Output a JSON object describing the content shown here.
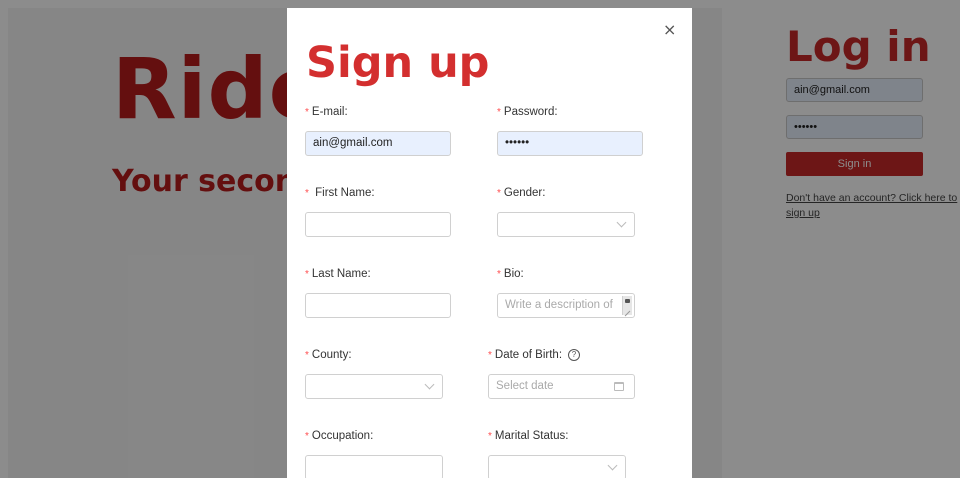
{
  "background": {
    "brand": "Ride",
    "tagline": "Your second",
    "login": {
      "title": "Log in",
      "email_value": "ain@gmail.com",
      "password_value": "••••••",
      "submit_label": "Sign in",
      "signup_link": "Don't have an account? Click here to sign up"
    }
  },
  "modal": {
    "title": "Sign up",
    "close_glyph": "×",
    "fields": {
      "email": {
        "label": "E-mail",
        "value": "ain@gmail.com"
      },
      "password": {
        "label": "Password",
        "value": "••••••"
      },
      "first_name": {
        "label": "First Name",
        "value": ""
      },
      "gender": {
        "label": "Gender",
        "value": ""
      },
      "last_name": {
        "label": "Last Name",
        "value": ""
      },
      "bio": {
        "label": "Bio",
        "placeholder": "Write a description of"
      },
      "county": {
        "label": "County",
        "value": ""
      },
      "date_of_birth": {
        "label": "Date of Birth",
        "placeholder": "Select date",
        "help_glyph": "?"
      },
      "occupation": {
        "label": "Occupation",
        "value": ""
      },
      "marital_status": {
        "label": "Marital Status",
        "value": ""
      }
    },
    "required_mark": "*",
    "label_suffix": ":"
  },
  "icons": {
    "close": "close-icon",
    "select": "chevron-down-icon",
    "calendar": "calendar-icon",
    "help": "question-circle-icon"
  },
  "colors": {
    "brand_red": "#b71c1c",
    "title_red": "#d32f2f",
    "required_red": "#ff4d4f",
    "autofill_blue": "#e8f0fe"
  }
}
